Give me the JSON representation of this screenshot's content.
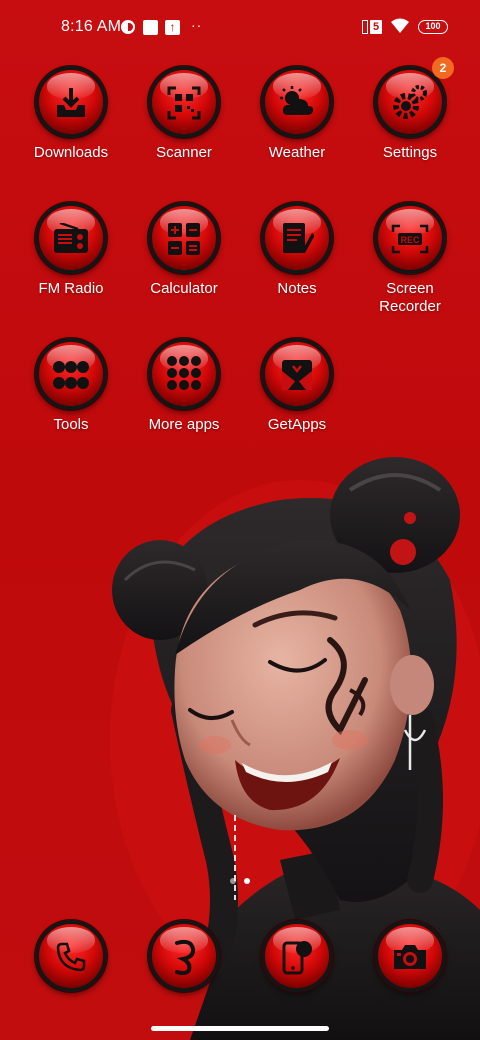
{
  "status_bar": {
    "time": "8:16 AM",
    "sim_label": "5",
    "battery": "100",
    "icons": [
      "data-saver-icon",
      "notification-box-icon",
      "upload-icon",
      "more-dots-icon",
      "sim-signal-icon",
      "wifi-icon",
      "battery-icon"
    ]
  },
  "apps": [
    {
      "label": "Downloads",
      "icon": "download-tray-icon"
    },
    {
      "label": "Scanner",
      "icon": "qr-scanner-icon"
    },
    {
      "label": "Weather",
      "icon": "sun-cloud-icon"
    },
    {
      "label": "Settings",
      "icon": "gears-icon",
      "badge": "2"
    },
    {
      "label": "FM Radio",
      "icon": "radio-icon"
    },
    {
      "label": "Calculator",
      "icon": "calculator-icon"
    },
    {
      "label": "Notes",
      "icon": "notepad-pen-icon"
    },
    {
      "label": "Screen\nRecorder",
      "icon": "rec-icon",
      "rec_text": "REC"
    },
    {
      "label": "Tools",
      "icon": "tools-grid-icon"
    },
    {
      "label": "More apps",
      "icon": "apps-grid-icon"
    },
    {
      "label": "GetApps",
      "icon": "getapps-bag-icon"
    }
  ],
  "dock": [
    {
      "name": "phone",
      "icon": "phone-icon"
    },
    {
      "name": "messages",
      "icon": "message-icon"
    },
    {
      "name": "browser",
      "icon": "mobile-browser-icon"
    },
    {
      "name": "camera",
      "icon": "camera-icon"
    }
  ],
  "colors": {
    "background": "#c70d10",
    "icon_rim": "#151515",
    "badge": "#f26a21"
  },
  "pager": {
    "pages": 2,
    "active": 2
  }
}
